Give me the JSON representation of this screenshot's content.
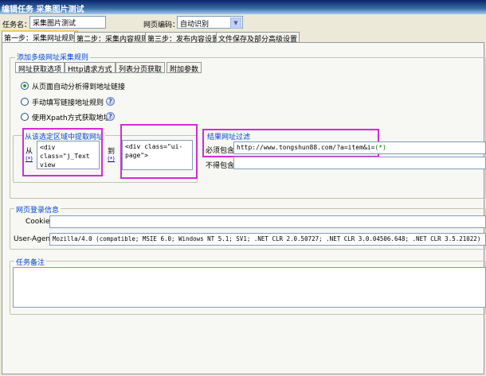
{
  "window": {
    "title": "编辑任务  采集图片测试"
  },
  "task": {
    "name_label": "任务名：",
    "name_value": "采集图片测试",
    "encoding_label": "网页编码：",
    "encoding_value": "自动识别"
  },
  "tabs": [
    {
      "label": "第一步：采集网址规则"
    },
    {
      "label": "第二步：采集内容规则"
    },
    {
      "label": "第三步：发布内容设置"
    },
    {
      "label": "文件保存及部分高级设置"
    }
  ],
  "rules_group": {
    "title": "添加多级网址采集规则",
    "subtabs": [
      {
        "label": "网址获取选项"
      },
      {
        "label": "Http请求方式"
      },
      {
        "label": "列表分页获取"
      },
      {
        "label": "附加参数"
      }
    ],
    "radios": [
      {
        "label": "从页面自动分析得到地址链接",
        "selected": true
      },
      {
        "label": "手动填写链接地址规则",
        "selected": false
      },
      {
        "label": "使用Xpath方式获取地址",
        "selected": false
      }
    ]
  },
  "extract": {
    "title": "从该选定区域中提取网址",
    "from_label": "从",
    "from_token": "(*)",
    "start_value": "<div class=\"j_Text\nview clearfix\">",
    "to_label": "到",
    "to_token": "(*)",
    "end_value": "<div class=\"ui-page\">"
  },
  "filter": {
    "title": "结果网址过滤",
    "must_label": "必须包含",
    "must_value": "http://www.tongshun88.com/?a=item&i=",
    "must_token": "(*)",
    "exclude_label": "不得包含",
    "exclude_value": ""
  },
  "login": {
    "title": "网页登录信息",
    "cookie_label": "Cookie",
    "cookie_value": "",
    "ua_label": "User-Agent",
    "ua_value": "Mozilla/4.0 (compatible; MSIE 6.0; Windows NT 5.1; SV1; .NET CLR 2.0.50727; .NET CLR 3.0.04506.648; .NET CLR 3.5.21022)"
  },
  "notes": {
    "title": "任务备注",
    "value": ""
  },
  "colors": {
    "highlight": "#d62ad6",
    "group_title": "#0046d5",
    "titlebar": "#0a246a"
  }
}
